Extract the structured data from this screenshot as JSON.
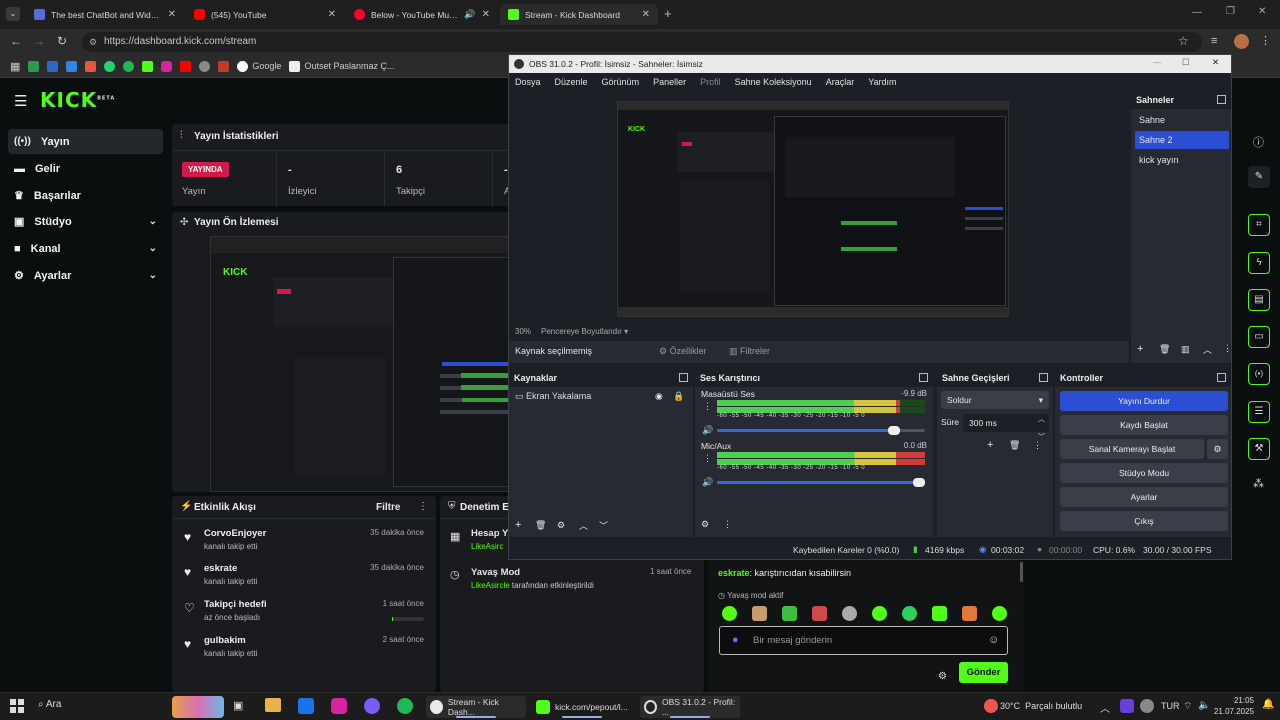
{
  "browser": {
    "tabs": [
      {
        "label": "The best ChatBot and Widgets",
        "fav": "#5a6ad8"
      },
      {
        "label": "(545) YouTube",
        "fav": "#ff0000"
      },
      {
        "label": "Below - YouTube Music",
        "fav": "#ff0033"
      },
      {
        "label": "Stream - Kick Dashboard",
        "fav": "#53fc18"
      }
    ],
    "url": "https://dashboard.kick.com/stream",
    "bookmarks": [
      {
        "label": "Google"
      },
      {
        "label": "Outset Paslanmaz Ç..."
      }
    ]
  },
  "kick": {
    "logo": "KICK",
    "logo_tag": "BETA",
    "nav": [
      {
        "label": "Yayın",
        "icon": "broadcast-icon",
        "active": true
      },
      {
        "label": "Gelir",
        "icon": "money-icon"
      },
      {
        "label": "Başarılar",
        "icon": "trophy-icon"
      },
      {
        "label": "Stüdyo",
        "icon": "studio-icon",
        "chevron": true
      },
      {
        "label": "Kanal",
        "icon": "channel-icon",
        "chevron": true
      },
      {
        "label": "Ayarlar",
        "icon": "settings-icon",
        "chevron": true
      }
    ],
    "stats": {
      "title": "Yayın İstatistikleri",
      "live_badge": "YAYINDA",
      "live_label": "Yayın",
      "viewers_value": "-",
      "viewers_label": "İzleyici",
      "followers_value": "6",
      "followers_label": "Takipçi",
      "extra_value": "-",
      "extra_label": "A"
    },
    "preview": {
      "title": "Yayın Ön İzlemesi"
    },
    "activity": {
      "title": "Etkinlik Akışı",
      "filter": "Filtre",
      "items": [
        {
          "name": "CorvoEnjoyer",
          "sub": "kanalı takip etti",
          "time": "35 dakika önce",
          "icon": "heart-icon"
        },
        {
          "name": "eskrate",
          "sub": "kanalı takip etti",
          "time": "35 dakika önce",
          "icon": "heart-icon"
        },
        {
          "name": "Takipçi hedefi",
          "sub": "az önce başladı",
          "time": "1 saat önce",
          "icon": "heart-outline-icon",
          "progress": 0.03
        },
        {
          "name": "gulbakim",
          "sub": "kanalı takip etti",
          "time": "2 saat önce",
          "icon": "heart-icon"
        }
      ]
    },
    "moderation": {
      "title": "Denetim Ey",
      "items": [
        {
          "name": "Hesap Y",
          "by": "LikeAsirc",
          "rest": ""
        },
        {
          "name": "Yavaş Mod",
          "by": "LikeAsircle",
          "rest": " tarafından etkinleştirildi",
          "time": "1 saat önce"
        }
      ]
    },
    "chat": {
      "last_user": "eskrate",
      "last_msg": ": karıştırıcıdan kısabilirsin",
      "slow_mode": "Yavaş mod aktif",
      "input_placeholder": "Bir mesaj gönderin",
      "send": "Gönder"
    },
    "right_icons": [
      "info-icon",
      "pencil-icon",
      "crop-icon",
      "bolt-icon",
      "clipboard-icon",
      "chat-icon",
      "broadcast-icon",
      "list-icon",
      "wrench-icon",
      "people-icon"
    ]
  },
  "obs": {
    "title": "OBS 31.0.2 - Profil: İsimsiz - Sahneler: İsimsiz",
    "menu": [
      "Dosya",
      "Düzenle",
      "Görünüm",
      "Paneller",
      "Profil",
      "Sahne Koleksiyonu",
      "Araçlar",
      "Yardım"
    ],
    "zoom": "30%",
    "fit": "Pencereye Boyutlandır",
    "no_source": "Kaynak seçilmemiş",
    "props": "Özellikler",
    "filters": "Filtreler",
    "scenes_title": "Sahneler",
    "scenes": [
      "Sahne",
      "Sahne 2",
      "kick yayın"
    ],
    "selected_scene": 1,
    "sources_title": "Kaynaklar",
    "sources": [
      "Ekran Yakalama"
    ],
    "mixer_title": "Ses Karıştırıcı",
    "channels": [
      {
        "name": "Masaüstü Ses",
        "db": "-9.9 dB",
        "level": 0.88
      },
      {
        "name": "Mic/Aux",
        "db": "0.0 dB",
        "level": 1.0
      }
    ],
    "scale": "-60 -55 -50 -45 -40 -35 -30 -25 -20 -15 -10 -5 0",
    "transitions_title": "Sahne Geçişleri",
    "transition": "Soldur",
    "duration_label": "Süre",
    "duration": "300 ms",
    "controls_title": "Kontroller",
    "controls": [
      "Yayını Durdur",
      "Kaydı Başlat",
      "Sanal Kamerayı Başlat",
      "Stüdyo Modu",
      "Ayarlar",
      "Çıkış"
    ],
    "status": {
      "dropped": "Kaybedilen Kareler 0 (%0.0)",
      "bitrate": "4169 kbps",
      "stream_time": "00:03:02",
      "rec_time": "00:00:00",
      "cpu": "CPU: 0.6%",
      "fps": "30.00 / 30.00 FPS"
    }
  },
  "taskbar": {
    "search": "Ara",
    "apps": [
      {
        "label": "Stream - Kick Dash...",
        "color": "#e9e9e9"
      },
      {
        "label": "kick.com/pepout/l...",
        "color": "#53fc18"
      },
      {
        "label": "OBS 31.0.2 - Profil: ...",
        "color": "#222"
      }
    ],
    "weather_temp": "30°C",
    "weather_desc": "Parçalı bulutlu",
    "lang": "TUR",
    "time": "21:05",
    "date": "21.07.2025"
  }
}
